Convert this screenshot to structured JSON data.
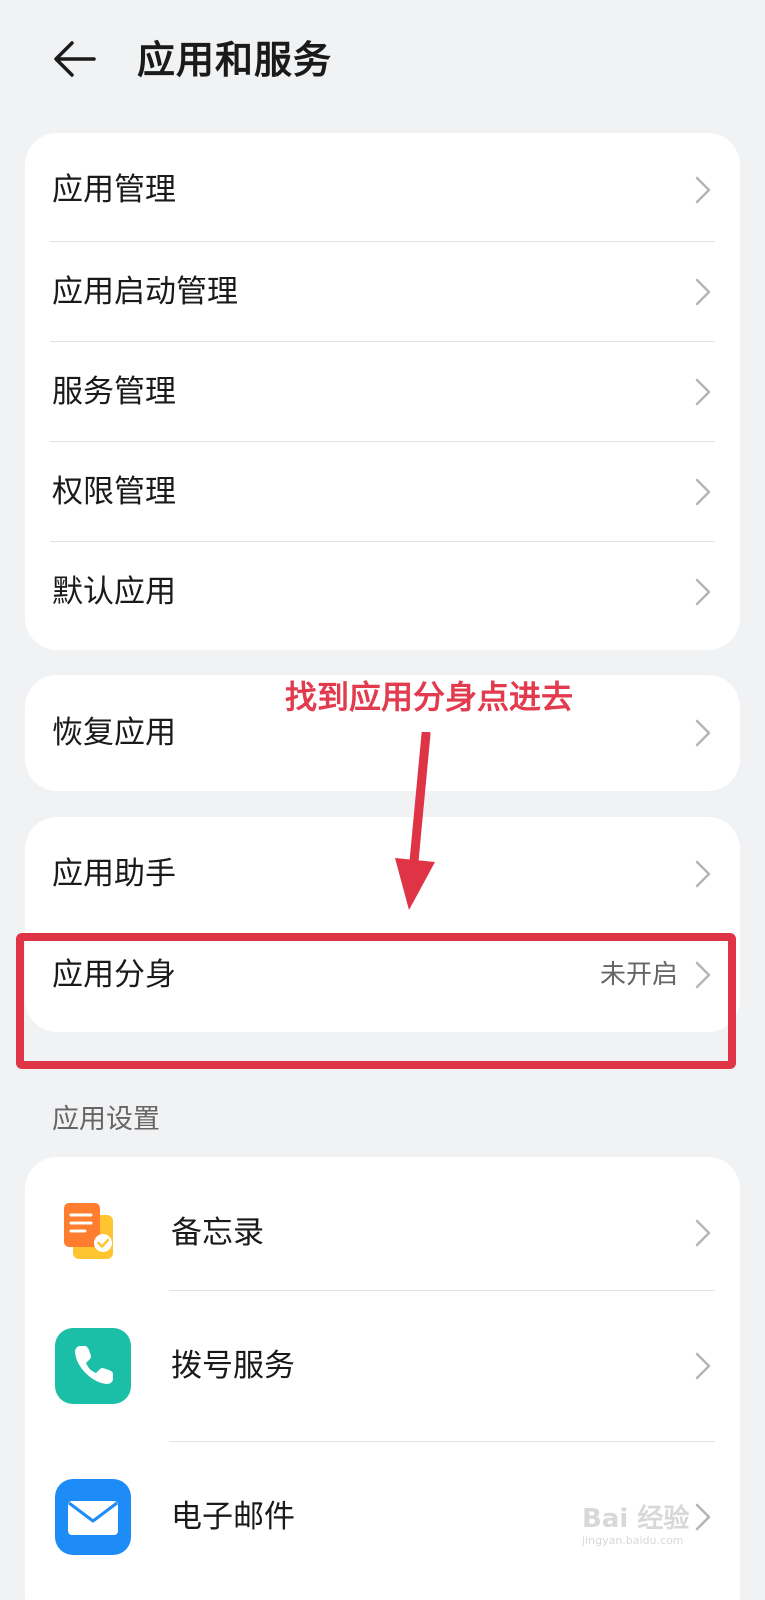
{
  "header": {
    "title": "应用和服务",
    "back_icon": "back-arrow-icon"
  },
  "group1": {
    "items": [
      {
        "label": "应用管理"
      },
      {
        "label": "应用启动管理"
      },
      {
        "label": "服务管理"
      },
      {
        "label": "权限管理"
      },
      {
        "label": "默认应用"
      }
    ]
  },
  "group2": {
    "items": [
      {
        "label": "恢复应用"
      }
    ]
  },
  "group3": {
    "items": [
      {
        "label": "应用助手"
      },
      {
        "label": "应用分身",
        "value": "未开启"
      }
    ]
  },
  "annotation": {
    "text": "找到应用分身点进去",
    "color": "#e23b4e"
  },
  "app_settings": {
    "section_label": "应用设置",
    "items": [
      {
        "label": "备忘录",
        "icon": "notes-app-icon"
      },
      {
        "label": "拨号服务",
        "icon": "phone-app-icon"
      },
      {
        "label": "电子邮件",
        "icon": "email-app-icon"
      }
    ]
  },
  "watermark": {
    "text": "Bai 经验",
    "sub": "jingyan.baidu.com"
  },
  "colors": {
    "background": "#f1f2f4",
    "card": "#ffffff",
    "highlight": "#df3446",
    "chevron": "#b5b5b5"
  }
}
